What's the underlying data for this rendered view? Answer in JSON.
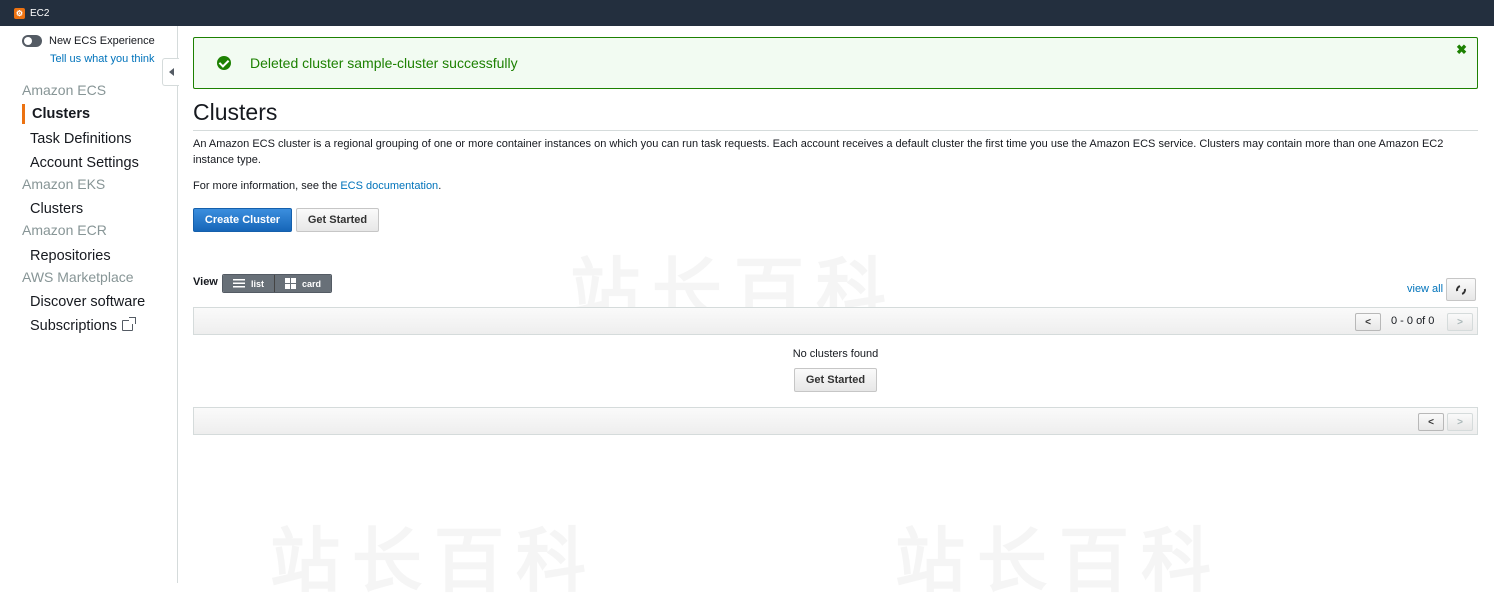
{
  "topbar": {
    "logo_glyph": "⚙",
    "title": "EC2"
  },
  "sidebar": {
    "toggle_label": "New ECS Experience",
    "feedback_link": "Tell us what you think",
    "collapse_icon": "caret-left-icon",
    "sections": [
      {
        "title": "Amazon ECS",
        "items": [
          {
            "label": "Clusters",
            "active": true
          },
          {
            "label": "Task Definitions"
          },
          {
            "label": "Account Settings"
          }
        ]
      },
      {
        "title": "Amazon EKS",
        "items": [
          {
            "label": "Clusters"
          }
        ]
      },
      {
        "title": "Amazon ECR",
        "items": [
          {
            "label": "Repositories"
          }
        ]
      },
      {
        "title": "AWS Marketplace",
        "items": [
          {
            "label": "Discover software"
          },
          {
            "label": "Subscriptions",
            "icon": "external-link-icon"
          }
        ]
      }
    ]
  },
  "flash": {
    "type": "success",
    "message": "Deleted cluster sample-cluster successfully",
    "close_glyph": "✖",
    "color": "#1d8102"
  },
  "main": {
    "title": "Clusters",
    "description": "An Amazon ECS cluster is a regional grouping of one or more container instances on which you can run task requests. Each account receives a default cluster the first time you use the Amazon ECS service. Clusters may contain more than one Amazon EC2 instance type.",
    "more_info_prefix": "For more information, see the ",
    "more_info_link": "ECS documentation",
    "more_info_suffix": ".",
    "create_button": "Create Cluster",
    "get_started_button": "Get Started",
    "view_label": "View",
    "view_options": [
      "list",
      "card"
    ],
    "view_all": "view all",
    "pagination": {
      "prev": "<",
      "next": ">",
      "range": "0 - 0 of 0"
    },
    "empty_text": "No clusters found",
    "empty_button": "Get Started"
  },
  "colors": {
    "topbar": "#232f3e",
    "accent": "#ec7211",
    "link": "#0073bb",
    "primary_button": "#1666b8"
  }
}
